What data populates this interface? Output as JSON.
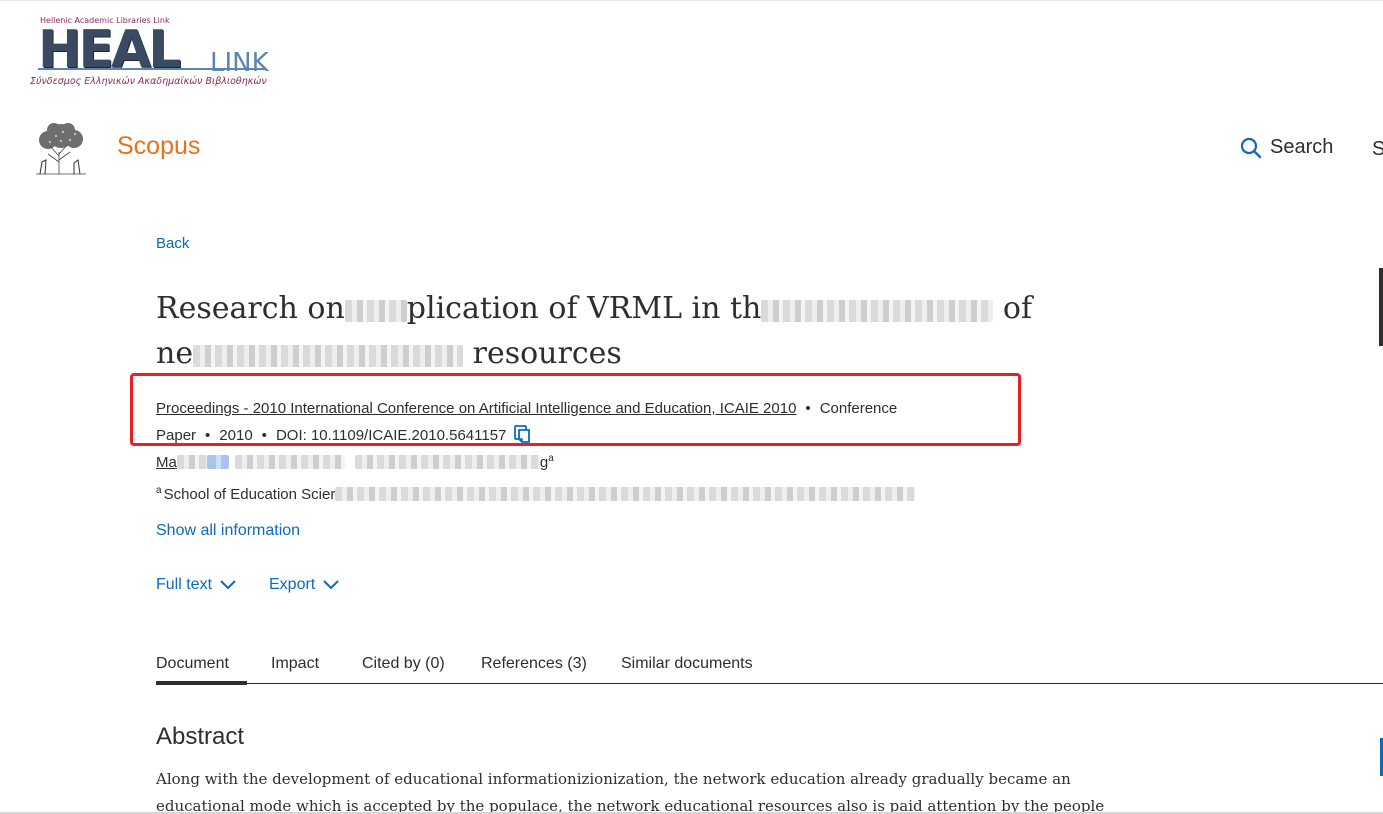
{
  "heal_logo": {
    "top_text": "Hellenic Academic Libraries Link",
    "word": "HEAL",
    "link": "LINK",
    "subtitle": "Σύνδεσμος Ελληνικών Ακαδημαϊκών Βιβλιοθηκών"
  },
  "header": {
    "brand": "Scopus",
    "search_label": "Search",
    "cut_nav": "S",
    "icons": [
      "elsevier-tree-logo",
      "search-icon"
    ]
  },
  "back_label": "Back",
  "document": {
    "title_line1_start": "Research on",
    "title_line1_mid1": "plication of VRML in th",
    "title_line1_end": "of",
    "title_line2_start": "ne",
    "title_line2_end": "resources",
    "source_title": "Proceedings - 2010 International Conference on Artificial Intelligence and Education, ICAIE 2010",
    "doc_type": "Conference Paper",
    "year": "2010",
    "doi": "DOI: 10.1109/ICAIE.2010.5641157",
    "author_visible_start": "Ma",
    "author_visible_end": "g",
    "author_sup": "a",
    "affil_sup": "a",
    "affil_visible": "School of Education Scier"
  },
  "show_all_label": "Show all information",
  "actions": {
    "full_text": "Full text",
    "export": "Export"
  },
  "tabs": [
    {
      "label": "Document",
      "active": true
    },
    {
      "label": "Impact"
    },
    {
      "label": "Cited by (0)"
    },
    {
      "label": "References (3)"
    },
    {
      "label": "Similar documents"
    }
  ],
  "abstract": {
    "heading": "Abstract",
    "text": "Along with the development of educational informationizionization, the network education already gradually became an educational mode which is accepted by the populace, the network educational resources also is paid attention by the people day after day"
  },
  "colors": {
    "scopus_orange": "#e9711c",
    "link_blue": "#0c6abf",
    "highlight_red": "#e8211c",
    "text": "#2e2e2e"
  }
}
